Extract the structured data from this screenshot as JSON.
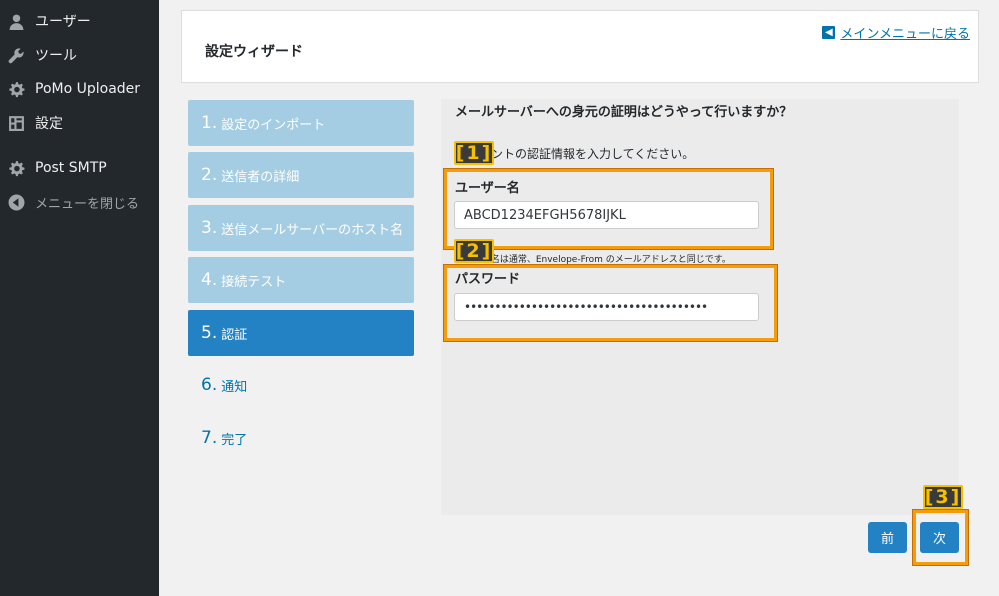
{
  "sidebar": {
    "items": [
      {
        "label": "ユーザー",
        "icon": "user-icon"
      },
      {
        "label": "ツール",
        "icon": "wrench-icon"
      },
      {
        "label": "PoMo Uploader",
        "icon": "gear-icon"
      },
      {
        "label": "設定",
        "icon": "settings-icon"
      },
      {
        "label": "Post SMTP",
        "icon": "gear-icon"
      },
      {
        "label": "メニューを閉じる",
        "icon": "collapse-icon"
      }
    ]
  },
  "header": {
    "title": "設定ウィザード",
    "back_link": "メインメニューに戻る"
  },
  "steps": [
    {
      "num": "1.",
      "label": "設定のインポート",
      "state": "done"
    },
    {
      "num": "2.",
      "label": "送信者の詳細",
      "state": "done"
    },
    {
      "num": "3.",
      "label": "送信メールサーバーのホスト名",
      "state": "done"
    },
    {
      "num": "4.",
      "label": "接続テスト",
      "state": "done"
    },
    {
      "num": "5.",
      "label": "認証",
      "state": "active"
    },
    {
      "num": "6.",
      "label": "通知",
      "state": "todo"
    },
    {
      "num": "7.",
      "label": "完了",
      "state": "todo"
    }
  ],
  "main": {
    "question": "メールサーバーへの身元の証明はどうやって行いますか？",
    "description": "アカウントの認証情報を入力してください。",
    "username_label": "ユーザー名",
    "username_value": "ABCD1234EFGH5678IJKL",
    "username_note": "ユーザー名は通常、Envelope-From のメールアドレスと同じです。",
    "password_label": "パスワード",
    "password_value": "••••••••••••••••••••••••••••••••••••••••"
  },
  "buttons": {
    "prev": "前",
    "next": "次"
  },
  "annotations": {
    "tag1": "[1]",
    "tag2": "[2]",
    "tag3": "[3]"
  },
  "colors": {
    "sidebar_bg": "#23282d",
    "accent": "#2282c3",
    "done_step": "#a4cde3",
    "highlight": "#f29c0e"
  }
}
